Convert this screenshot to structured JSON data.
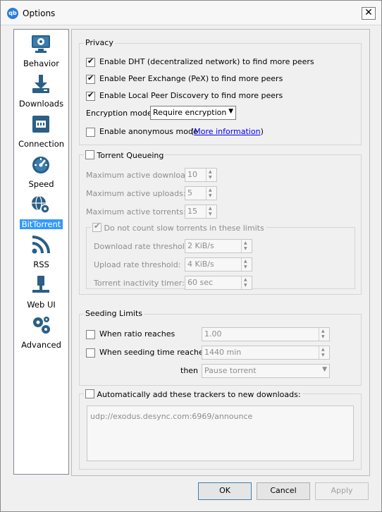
{
  "window": {
    "title": "Options",
    "icon_text": "qb"
  },
  "sidebar": {
    "items": [
      {
        "label": "Behavior",
        "icon": "monitor-gear-icon"
      },
      {
        "label": "Downloads",
        "icon": "download-icon"
      },
      {
        "label": "Connection",
        "icon": "network-port-icon"
      },
      {
        "label": "Speed",
        "icon": "speedometer-icon"
      },
      {
        "label": "BitTorrent",
        "icon": "globe-gear-icon",
        "active": true
      },
      {
        "label": "RSS",
        "icon": "rss-icon"
      },
      {
        "label": "Web UI",
        "icon": "network-plug-icon"
      },
      {
        "label": "Advanced",
        "icon": "gears-icon"
      }
    ]
  },
  "privacy": {
    "title": "Privacy",
    "dht": {
      "label": "Enable DHT (decentralized network) to find more peers",
      "checked": true
    },
    "pex": {
      "label": "Enable Peer Exchange (PeX) to find more peers",
      "checked": true
    },
    "lpd": {
      "label": "Enable Local Peer Discovery to find more peers",
      "checked": true
    },
    "encryption_label": "Encryption mode:",
    "encryption_value": "Require encryption",
    "anon": {
      "label": "Enable anonymous mode",
      "checked": false
    },
    "more_info_open": "(",
    "more_info_link": "More information",
    "more_info_close": ")"
  },
  "queueing": {
    "title": "Torrent Queueing",
    "checked": false,
    "max_downloads": {
      "label": "Maximum active downloads:",
      "value": "10"
    },
    "max_uploads": {
      "label": "Maximum active uploads:",
      "value": "5"
    },
    "max_torrents": {
      "label": "Maximum active torrents:",
      "value": "15"
    },
    "slow": {
      "title": "Do not count slow torrents in these limits",
      "checked": true,
      "download_threshold": {
        "label": "Download rate threshold:",
        "value": "2 KiB/s"
      },
      "upload_threshold": {
        "label": "Upload rate threshold:",
        "value": "4 KiB/s"
      },
      "inactivity_timer": {
        "label": "Torrent inactivity timer:",
        "value": "60 sec"
      }
    }
  },
  "seeding": {
    "title": "Seeding Limits",
    "ratio": {
      "label": "When ratio reaches",
      "value": "1.00",
      "checked": false
    },
    "time": {
      "label": "When seeding time reaches",
      "value": "1440 min",
      "checked": false
    },
    "then_label": "then",
    "then_value": "Pause torrent"
  },
  "trackers": {
    "label": "Automatically add these trackers to new downloads:",
    "checked": false,
    "value": "udp://exodus.desync.com:6969/announce"
  },
  "buttons": {
    "ok": "OK",
    "cancel": "Cancel",
    "apply": "Apply"
  }
}
